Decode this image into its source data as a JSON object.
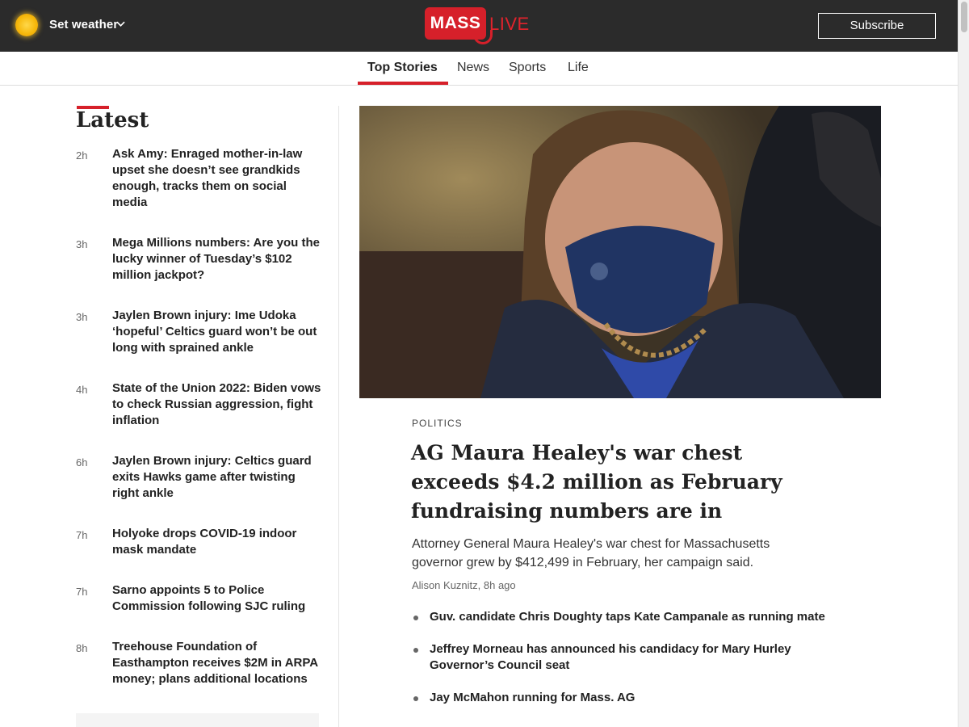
{
  "header": {
    "weather_label": "Set weather",
    "logo_mass": "MASS",
    "logo_live": "LIVE",
    "subscribe_label": "Subscribe"
  },
  "nav": {
    "tabs": [
      {
        "label": "Top Stories",
        "active": true
      },
      {
        "label": "News"
      },
      {
        "label": "Sports"
      },
      {
        "label": "Life"
      }
    ]
  },
  "latest": {
    "title": "Latest",
    "items": [
      {
        "time": "2h",
        "headline": "Ask Amy: Enraged mother-in-law upset she doesn’t see grandkids enough, tracks them on social media"
      },
      {
        "time": "3h",
        "headline": "Mega Millions numbers: Are you the lucky winner of Tuesday’s $102 million jackpot?"
      },
      {
        "time": "3h",
        "headline": "Jaylen Brown injury: Ime Udoka ‘hopeful’ Celtics guard won’t be out long with sprained ankle"
      },
      {
        "time": "4h",
        "headline": "State of the Union 2022: Biden vows to check Russian aggression, fight inflation"
      },
      {
        "time": "6h",
        "headline": "Jaylen Brown injury: Celtics guard exits Hawks game after twisting right ankle"
      },
      {
        "time": "7h",
        "headline": "Holyoke drops COVID-19 indoor mask mandate"
      },
      {
        "time": "7h",
        "headline": "Sarno appoints 5 to Police Commission following SJC ruling"
      },
      {
        "time": "8h",
        "headline": "Treehouse Foundation of Easthampton receives $2M in ARPA money; plans additional locations"
      }
    ]
  },
  "lead_story": {
    "kicker": "POLITICS",
    "headline": "AG Maura Healey's war chest exceeds $4.2 million as February fundraising numbers are in",
    "dek": "Attorney General Maura Healey's war chest for Massachusetts governor grew by $412,499 in February, her campaign said.",
    "byline": "Alison Kuznitz, 8h ago",
    "related": [
      "Guv. candidate Chris Doughty taps Kate Campanale as running mate",
      "Jeffrey Morneau has announced his candidacy for Mary Hurley Governor’s Council seat",
      "Jay McMahon running for Mass. AG"
    ]
  },
  "colors": {
    "brand_red": "#d6202a",
    "topbar_bg": "#2b2b2b"
  }
}
